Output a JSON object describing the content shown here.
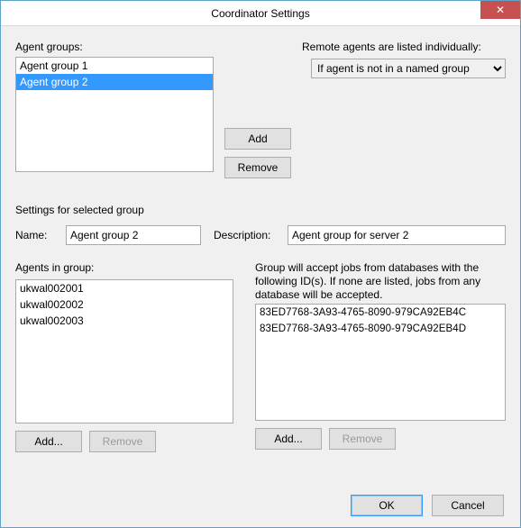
{
  "window": {
    "title": "Coordinator Settings"
  },
  "agentGroups": {
    "label": "Agent groups:",
    "items": [
      {
        "label": "Agent group 1",
        "selected": false
      },
      {
        "label": "Agent group 2",
        "selected": true
      }
    ],
    "addLabel": "Add",
    "removeLabel": "Remove"
  },
  "remote": {
    "label": "Remote agents are listed individually:",
    "selected": "If agent is not in a named group"
  },
  "groupSettings": {
    "heading": "Settings for selected group",
    "nameLabel": "Name:",
    "nameValue": "Agent group 2",
    "descLabel": "Description:",
    "descValue": "Agent group for server 2"
  },
  "agentsInGroup": {
    "label": "Agents in group:",
    "items": [
      {
        "label": "ukwal002001"
      },
      {
        "label": "ukwal002002"
      },
      {
        "label": "ukwal002003"
      }
    ],
    "addLabel": "Add...",
    "removeLabel": "Remove"
  },
  "databases": {
    "help": "Group will accept jobs from databases with the following ID(s). If none are listed, jobs from any database will be accepted.",
    "items": [
      {
        "label": "83ED7768-3A93-4765-8090-979CA92EB4C"
      },
      {
        "label": "83ED7768-3A93-4765-8090-979CA92EB4D"
      }
    ],
    "addLabel": "Add...",
    "removeLabel": "Remove"
  },
  "dialog": {
    "okLabel": "OK",
    "cancelLabel": "Cancel"
  }
}
